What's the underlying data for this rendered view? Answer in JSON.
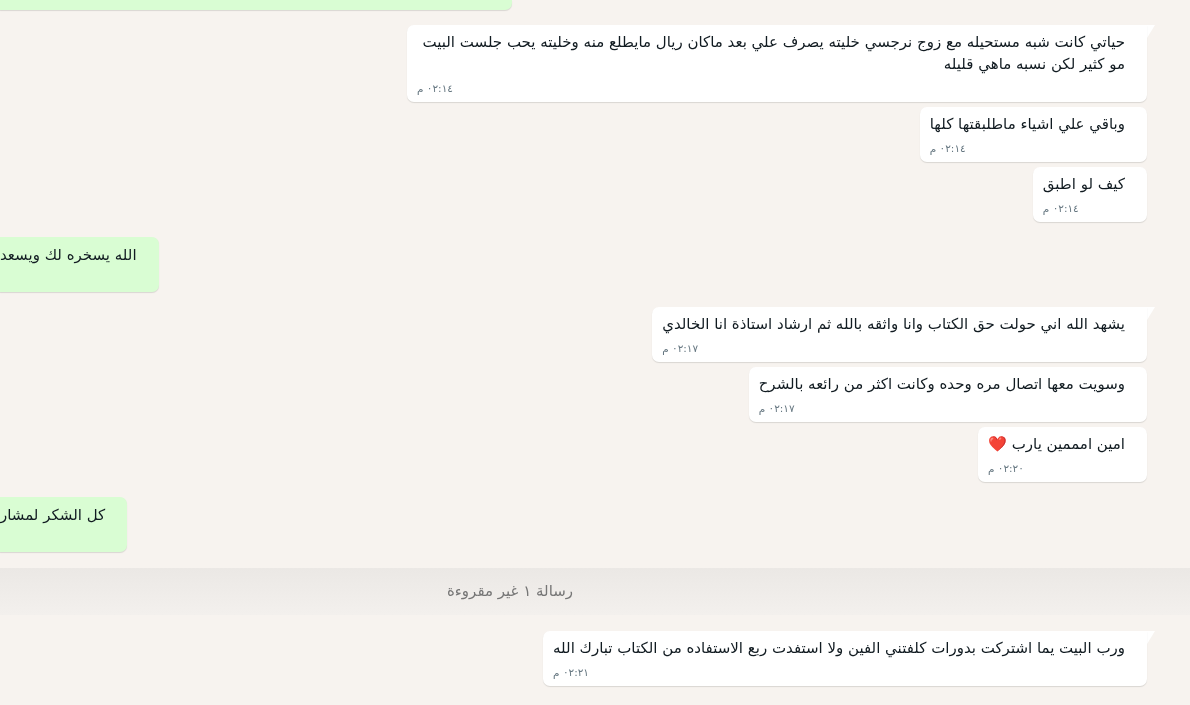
{
  "messages": [
    {
      "kind": "outgoing"
    },
    {
      "kind": "incoming",
      "text": "حياتي كانت شبه مستحيله مع زوج نرجسي خليته يصرف علي بعد ماكان ريال مايطلع منه وخليته يحب جلست البيت مو كثير لكن نسبه ماهي قليله",
      "time": "٠٢:١٤ م",
      "tail": true
    },
    {
      "kind": "incoming",
      "text": "وباقي علي اشياء ماطلبقتها كلها",
      "time": "٠٢:١٤ م",
      "tail": false
    },
    {
      "kind": "incoming",
      "text": "كيف لو اطبق",
      "time": "٠٢:١٤ م",
      "tail": false
    },
    {
      "kind": "outgoing",
      "text": "الله يسخره لك ويسعد"
    },
    {
      "kind": "incoming",
      "text": "يشهد الله اني حولت حق الكتاب وانا واثقه بالله ثم ارشاد استاذة انا الخالدي",
      "time": "٠٢:١٧ م",
      "tail": true
    },
    {
      "kind": "incoming",
      "text": "وسويت معها اتصال مره وحده وكانت اكثر من رائعه بالشرح",
      "time": "٠٢:١٧ م",
      "tail": false
    },
    {
      "kind": "incoming",
      "text": "امين امممين يارب ❤️",
      "time": "٠٢:٢٠ م",
      "tail": false
    },
    {
      "kind": "outgoing",
      "text": "كل الشكر لمشار"
    },
    {
      "kind": "divider",
      "text": "رسالة ١ غير مقروءة"
    },
    {
      "kind": "incoming",
      "text": "ورب البيت يما اشتركت بدورات كلفتني الفين ولا استفدت ربع الاستفاده من الكتاب تبارك الله",
      "time": "٠٢:٢١ م",
      "tail": true
    }
  ]
}
